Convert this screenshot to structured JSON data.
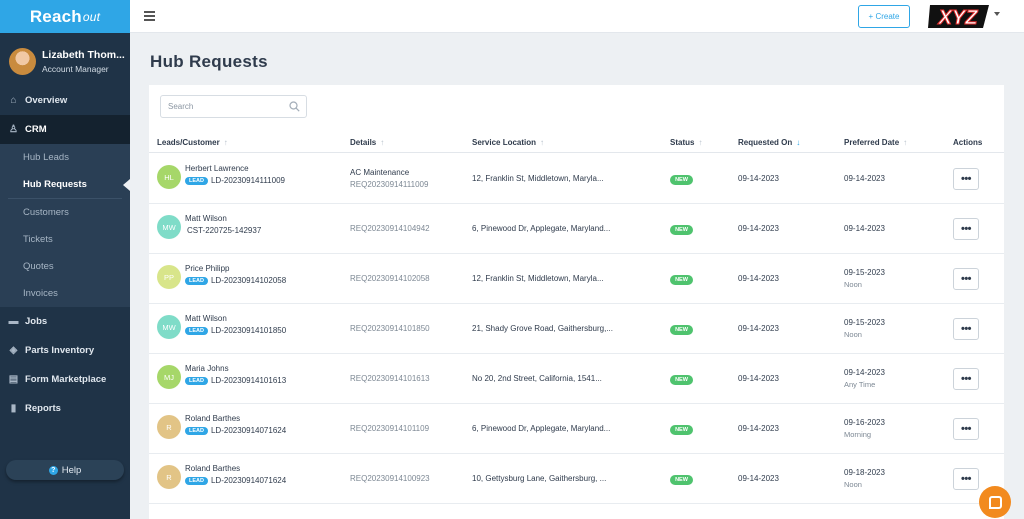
{
  "brand": {
    "name_main": "Reach",
    "name_italic": "out"
  },
  "user": {
    "name": "Lizabeth Thom...",
    "role": "Account Manager"
  },
  "sidebar": {
    "items": [
      {
        "label": "Overview",
        "icon": "home-icon"
      },
      {
        "label": "CRM",
        "icon": "person-pin-icon"
      },
      {
        "label": "Jobs",
        "icon": "briefcase-icon"
      },
      {
        "label": "Parts Inventory",
        "icon": "box-icon"
      },
      {
        "label": "Form Marketplace",
        "icon": "form-icon"
      },
      {
        "label": "Reports",
        "icon": "bar-chart-icon"
      }
    ],
    "crm_sub": [
      "Hub Leads",
      "Hub Requests",
      "Customers",
      "Tickets",
      "Quotes",
      "Invoices"
    ],
    "help": "Help"
  },
  "topbar": {
    "create_label": "+ Create",
    "logo_text": "XYZ"
  },
  "page": {
    "title": "Hub Requests"
  },
  "search": {
    "placeholder": "Search"
  },
  "table": {
    "columns": [
      "Leads/Customer",
      "Details",
      "Service Location",
      "Status",
      "Requested On",
      "Preferred Date",
      "Actions"
    ],
    "rows": [
      {
        "initials": "HL",
        "color": "#a6d769",
        "name": "Herbert Lawrence",
        "badge": "LEAD",
        "id": "LD-20230914111009",
        "detail1": "AC Maintenance",
        "detail2": "REQ20230914111009",
        "location": "12, Franklin St, Middletown, Maryla...",
        "status": "NEW",
        "requested": "09-14-2023",
        "preferred": "09-14-2023",
        "preferred_note": ""
      },
      {
        "initials": "MW",
        "color": "#7fdcc8",
        "name": "Matt Wilson",
        "badge": "",
        "id": "CST-220725-142937",
        "detail1": "",
        "detail2": "REQ20230914104942",
        "location": "6, Pinewood Dr, Applegate, Maryland...",
        "status": "NEW",
        "requested": "09-14-2023",
        "preferred": "09-14-2023",
        "preferred_note": ""
      },
      {
        "initials": "PP",
        "color": "#d8e58a",
        "name": "Price Philipp",
        "badge": "LEAD",
        "id": "LD-20230914102058",
        "detail1": "",
        "detail2": "REQ20230914102058",
        "location": "12, Franklin St, Middletown, Maryla...",
        "status": "NEW",
        "requested": "09-14-2023",
        "preferred": "09-15-2023",
        "preferred_note": "Noon"
      },
      {
        "initials": "MW",
        "color": "#7fdcc8",
        "name": "Matt Wilson",
        "badge": "LEAD",
        "id": "LD-20230914101850",
        "detail1": "",
        "detail2": "REQ20230914101850",
        "location": "21, Shady Grove Road, Gaithersburg,...",
        "status": "NEW",
        "requested": "09-14-2023",
        "preferred": "09-15-2023",
        "preferred_note": "Noon"
      },
      {
        "initials": "MJ",
        "color": "#a6d769",
        "name": "Maria Johns",
        "badge": "LEAD",
        "id": "LD-20230914101613",
        "detail1": "",
        "detail2": "REQ20230914101613",
        "location": "No 20, 2nd Street, California, 1541...",
        "status": "NEW",
        "requested": "09-14-2023",
        "preferred": "09-14-2023",
        "preferred_note": "Any Time"
      },
      {
        "initials": "R",
        "color": "#e2c486",
        "name": "Roland Barthes",
        "badge": "LEAD",
        "id": "LD-20230914071624",
        "detail1": "",
        "detail2": "REQ20230914101109",
        "location": "6, Pinewood Dr, Applegate, Maryland...",
        "status": "NEW",
        "requested": "09-14-2023",
        "preferred": "09-16-2023",
        "preferred_note": "Morning"
      },
      {
        "initials": "R",
        "color": "#e2c486",
        "name": "Roland Barthes",
        "badge": "LEAD",
        "id": "LD-20230914071624",
        "detail1": "",
        "detail2": "REQ20230914100923",
        "location": "10, Gettysburg Lane, Gaithersburg, ...",
        "status": "NEW",
        "requested": "09-14-2023",
        "preferred": "09-18-2023",
        "preferred_note": "Noon"
      }
    ]
  },
  "colors": {
    "accent": "#2fa6e6",
    "sidebar": "#1f3347",
    "status_new": "#4fc36e",
    "chat": "#f28a1e"
  }
}
